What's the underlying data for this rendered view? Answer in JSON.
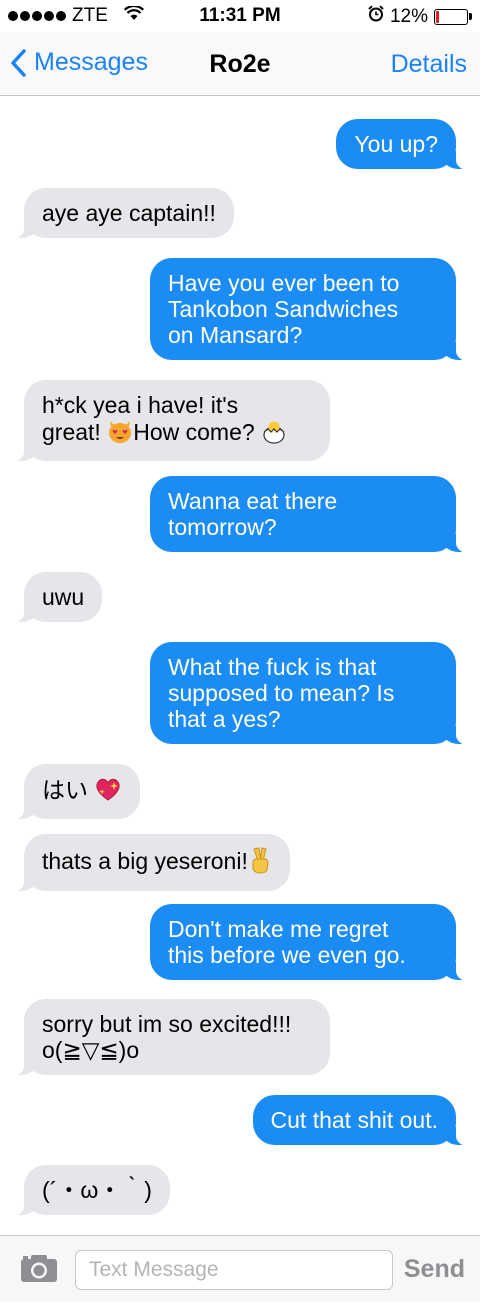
{
  "status_bar": {
    "carrier": "ZTE",
    "time": "11:31 PM",
    "battery_pct_label": "12%",
    "battery_level": 0.12,
    "alarm_icon": "alarm-clock-icon",
    "wifi_icon": "wifi-icon"
  },
  "nav": {
    "back_label": "Messages",
    "title": "Ro2e",
    "details_label": "Details"
  },
  "messages": [
    {
      "from": "me",
      "text": "You up?"
    },
    {
      "from": "them",
      "text": "aye aye captain!!"
    },
    {
      "from": "me",
      "text": "Have you ever been to\nTankobon Sandwiches\non Mansard?"
    },
    {
      "from": "them",
      "text_line1": "h*ck yea i have! it's",
      "text_line2a": "great! ",
      "emoji_a": "heart-eyes-cat-emoji",
      "text_line2b": "How come? ",
      "emoji_b": "hatching-chick-emoji"
    },
    {
      "from": "me",
      "text": "Wanna eat there\ntomorrow?"
    },
    {
      "from": "them",
      "text": "uwu"
    },
    {
      "from": "me",
      "text": "What the fuck is that\nsupposed to mean? Is\nthat a yes?"
    },
    {
      "from": "them",
      "text": "はい ",
      "emoji": "sparkling-heart-emoji"
    },
    {
      "from": "them",
      "text": "thats a big yeseroni!",
      "emoji": "victory-hand-emoji"
    },
    {
      "from": "me",
      "text": "Don't make me regret\nthis before we even go."
    },
    {
      "from": "them",
      "text": "sorry but im so excited!!!\no(≧▽≦)o"
    },
    {
      "from": "me",
      "text": "Cut that shit out."
    },
    {
      "from": "them",
      "text": "(´・ω・｀)"
    }
  ],
  "input_bar": {
    "camera_icon": "camera-icon",
    "placeholder": "Text Message",
    "send_label": "Send"
  },
  "colors": {
    "accent": "#1a82fb",
    "outgoing_bubble": "#1a8cf3",
    "incoming_bubble": "#e5e5ea"
  }
}
